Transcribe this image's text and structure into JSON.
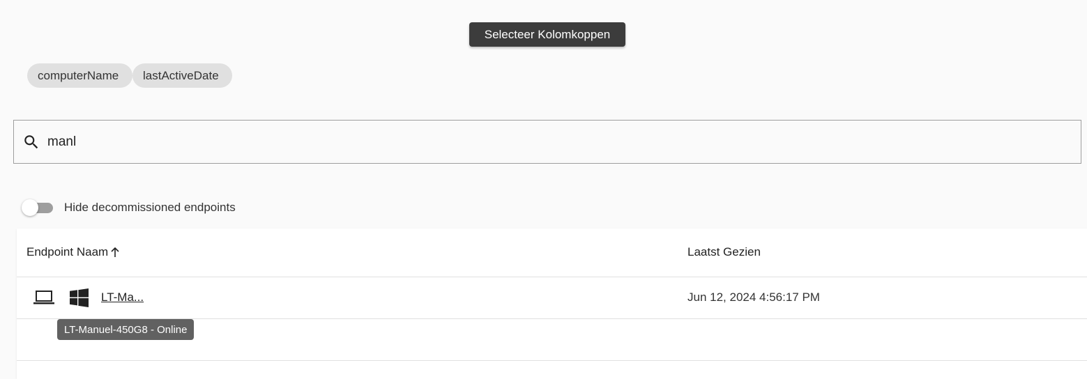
{
  "toolbar": {
    "select_columns_label": "Selecteer Kolomkoppen"
  },
  "column_chips": [
    {
      "label": "computerName"
    },
    {
      "label": "lastActiveDate"
    }
  ],
  "search": {
    "value": "manl",
    "icon": "search-icon"
  },
  "filter": {
    "hide_decommissioned_label": "Hide decommissioned endpoints",
    "hide_decommissioned_enabled": false
  },
  "table": {
    "columns": [
      {
        "label": "Endpoint Naam",
        "sort": "ascending"
      },
      {
        "label": "Laatst Gezien"
      }
    ],
    "rows": [
      {
        "device_icon": "laptop-icon",
        "os_icon": "windows-icon",
        "name": "LT-Ma...",
        "last_seen": "Jun 12, 2024 4:56:17 PM"
      }
    ]
  },
  "tooltip": {
    "text": "LT-Manuel-450G8 - Online"
  }
}
